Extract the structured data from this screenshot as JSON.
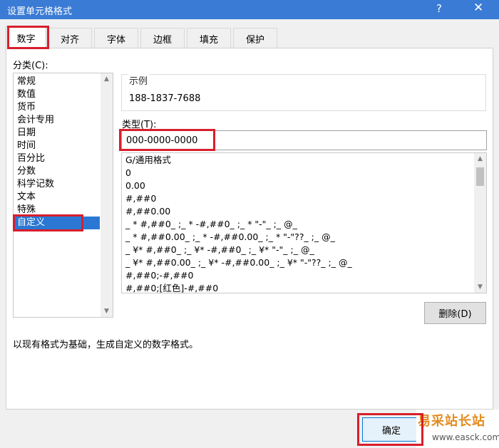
{
  "window": {
    "title": "设置单元格格式",
    "help_label": "?",
    "close_label": "✕"
  },
  "tabs": [
    {
      "label": "数字",
      "active": true
    },
    {
      "label": "对齐",
      "active": false
    },
    {
      "label": "字体",
      "active": false
    },
    {
      "label": "边框",
      "active": false
    },
    {
      "label": "填充",
      "active": false
    },
    {
      "label": "保护",
      "active": false
    }
  ],
  "category": {
    "label": "分类(C):",
    "items": [
      "常规",
      "数值",
      "货币",
      "会计专用",
      "日期",
      "时间",
      "百分比",
      "分数",
      "科学记数",
      "文本",
      "特殊",
      "自定义"
    ],
    "selected": "自定义"
  },
  "sample": {
    "title": "示例",
    "value": "188-1837-7688"
  },
  "type": {
    "label": "类型(T):",
    "value": "000-0000-0000"
  },
  "formats": [
    "G/通用格式",
    "0",
    "0.00",
    "#,##0",
    "#,##0.00",
    "_ * #,##0_ ;_ * -#,##0_ ;_ * \"-\"_ ;_ @_",
    "_ * #,##0.00_ ;_ * -#,##0.00_ ;_ * \"-\"??_ ;_ @_",
    "_ ¥* #,##0_ ;_ ¥* -#,##0_ ;_ ¥* \"-\"_ ;_ @_",
    "_ ¥* #,##0.00_ ;_ ¥* -#,##0.00_ ;_ ¥* \"-\"??_ ;_ @_",
    "#,##0;-#,##0",
    "#,##0;[红色]-#,##0"
  ],
  "buttons": {
    "delete_label": "删除(D)",
    "ok_label": "确定"
  },
  "description": "以现有格式为基础，生成自定义的数字格式。",
  "watermark": {
    "big": "易采站长站",
    "small": "www.easck.com"
  },
  "colors": {
    "titlebar": "#3a7bd5",
    "selection": "#2b78d4",
    "highlight_box": "#d81e2c",
    "watermark": "#e38c1f"
  }
}
